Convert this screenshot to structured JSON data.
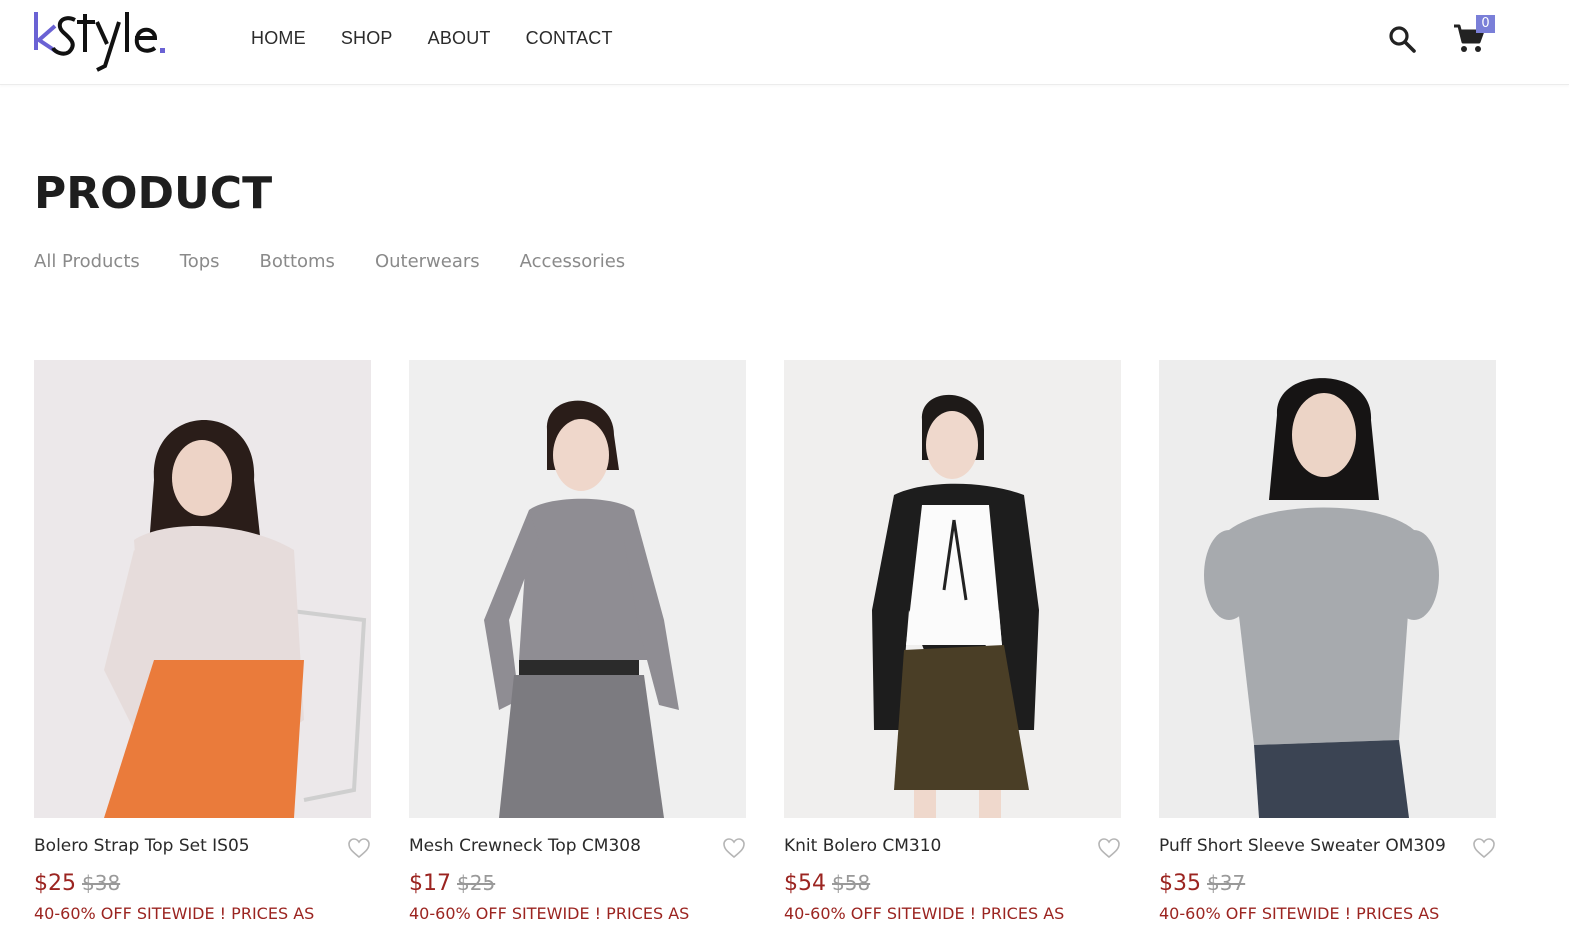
{
  "brand": {
    "name": "kStyle",
    "accent_color": "#6a62d4",
    "dot_color": "#6a62d4"
  },
  "nav": {
    "items": [
      {
        "label": "HOME"
      },
      {
        "label": "SHOP"
      },
      {
        "label": "ABOUT"
      },
      {
        "label": "CONTACT"
      }
    ]
  },
  "header": {
    "search_icon": "search-icon",
    "cart_icon": "cart-icon",
    "cart_count": "0"
  },
  "main": {
    "title": "PRODUCT",
    "categories": [
      {
        "label": "All Products"
      },
      {
        "label": "Tops"
      },
      {
        "label": "Bottoms"
      },
      {
        "label": "Outerwears"
      },
      {
        "label": "Accessories"
      }
    ]
  },
  "products": [
    {
      "name": "Bolero Strap Top Set IS05",
      "price": "$25",
      "old_price": "$38",
      "promo": "40-60% OFF SITEWIDE ! PRICES AS"
    },
    {
      "name": "Mesh Crewneck Top CM308",
      "price": "$17",
      "old_price": "$25",
      "promo": "40-60% OFF SITEWIDE ! PRICES AS"
    },
    {
      "name": "Knit Bolero CM310",
      "price": "$54",
      "old_price": "$58",
      "promo": "40-60% OFF SITEWIDE ! PRICES AS"
    },
    {
      "name": "Puff Short Sleeve Sweater OM309",
      "price": "$35",
      "old_price": "$37",
      "promo": "40-60% OFF SITEWIDE ! PRICES AS"
    }
  ],
  "colors": {
    "price": "#9b2420",
    "old_price": "#999999",
    "badge": "#7a7fd8"
  }
}
